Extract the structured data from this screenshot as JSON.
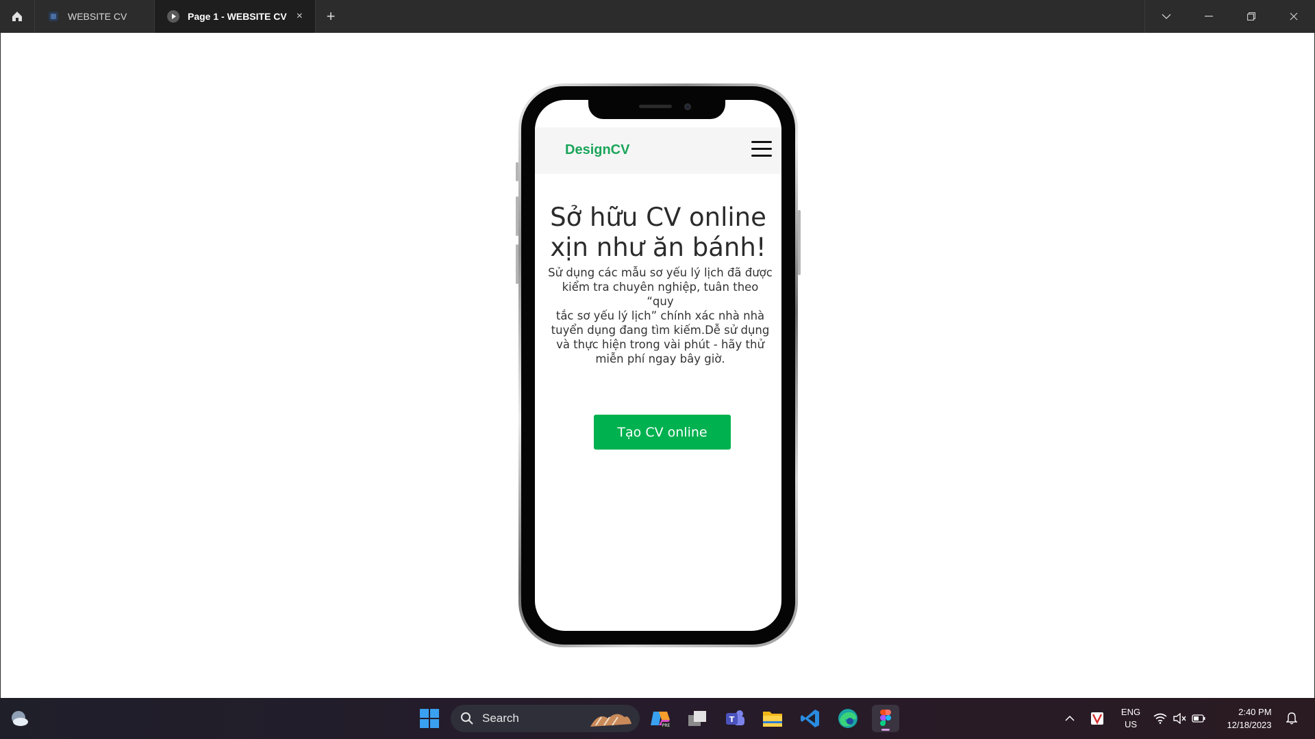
{
  "titlebar": {
    "tabs": [
      {
        "label": "WEBSITE CV"
      },
      {
        "label": "Page 1 - WEBSITE CV",
        "close": "×"
      }
    ],
    "add_tab": "+"
  },
  "phone_app": {
    "brand": "DesignCV",
    "hero_title_line1": "Sở hữu CV online",
    "hero_title_line2": "xịn như ăn bánh!",
    "description_lines": [
      "Sử dụng các mẫu sơ yếu lý lịch đã được",
      "kiểm tra chuyên nghiệp, tuân theo “quy",
      "tắc sơ yếu lý lịch” chính  xác nhà nhà",
      "tuyển dụng đang tìm kiếm.Dễ sử dụng",
      "và thực hiện trong vài phút - hãy thử",
      "miễn phí ngay bây giờ."
    ],
    "cta_label": "Tạo CV online",
    "colors": {
      "brand": "#1aa55a",
      "cta": "#00b14f"
    }
  },
  "taskbar": {
    "search_label": "Search",
    "lang_line1": "ENG",
    "lang_line2": "US",
    "time": "2:40 PM",
    "date": "12/18/2023"
  }
}
